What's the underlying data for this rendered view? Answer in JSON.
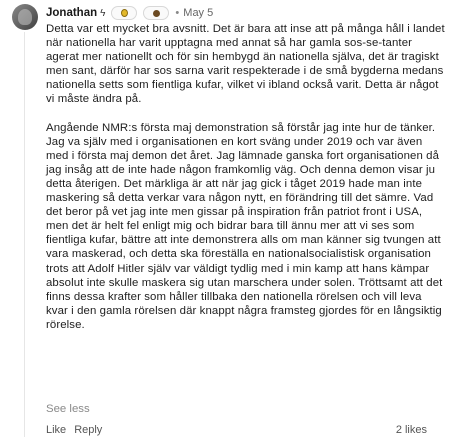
{
  "comment": {
    "author": "Jonathan",
    "flair_symbol": "ϟ",
    "separator": "•",
    "date": "May 5",
    "paragraphs": [
      "Detta var ett mycket bra avsnitt. Det är bara att inse att på många håll i landet när nationella har varit upptagna med annat så har gamla sos-se-tanter agerat mer nationellt och för sin hembygd än nationella själva, det är tragiskt men sant, därför har sos sarna varit respekterade i de små bygderna medans nationella setts som fientliga kufar, vilket vi ibland också varit. Detta är något vi måste ändra på.",
      "Angående NMR:s första maj demonstration så förstår jag inte hur de tänker. Jag va själv med i organisationen en kort sväng under 2019 och var även med i första maj demon det året. Jag lämnade ganska fort organisationen då jag insåg att de inte hade någon framkomlig väg. Och denna demon visar ju detta återigen. Det märkliga är att när jag gick i tåget 2019 hade man inte maskering så detta verkar vara någon nytt, en förändring till det sämre. Vad det beror på vet jag inte men gissar på inspiration från patriot front i USA, men det är helt fel enligt mig och bidrar bara till ännu mer att vi ses som fientliga kufar, bättre att inte demonstrera alls om man känner sig tvungen att vara maskerad, och detta ska föreställa en nationalsocialistisk organisation trots att Adolf Hitler själv var väldigt tydlig med i min kamp att hans kämpar absolut inte skulle maskera sig utan marschera under solen. Tröttsamt att det finns dessa krafter som håller tillbaka den nationella rörelsen och vill leva kvar i den gamla rörelsen där knappt några framsteg gjordes för en långsiktig rörelse."
    ],
    "see_less_label": "See less",
    "like_label": "Like",
    "reply_label": "Reply",
    "likes_count": "2 likes"
  },
  "icons": {
    "badge_1": "gold-medal-icon",
    "badge_2": "brown-circle-icon",
    "badge_1_color": "#e2b82a",
    "badge_2_color": "#6b4a22"
  }
}
